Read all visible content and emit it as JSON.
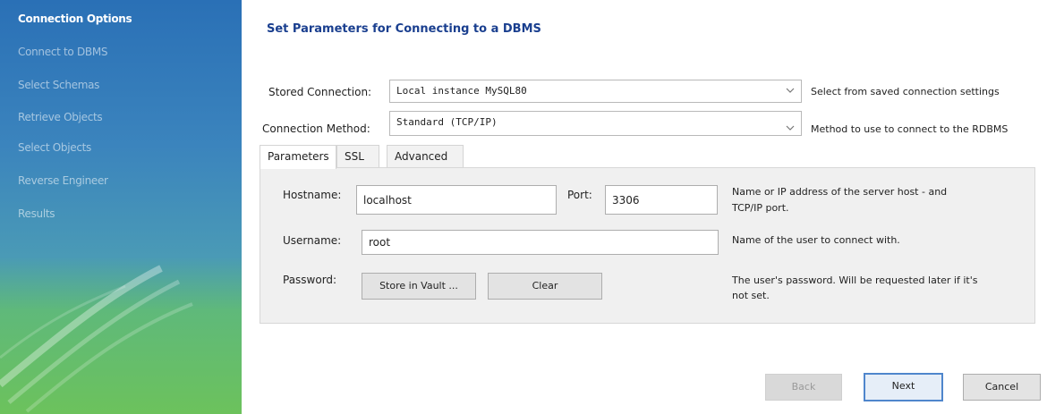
{
  "sidebar": {
    "items": [
      {
        "label": "Connection Options",
        "active": true
      },
      {
        "label": "Connect to DBMS",
        "active": false
      },
      {
        "label": "Select Schemas",
        "active": false
      },
      {
        "label": "Retrieve Objects",
        "active": false
      },
      {
        "label": "Select Objects",
        "active": false
      },
      {
        "label": "Reverse Engineer",
        "active": false
      },
      {
        "label": "Results",
        "active": false
      }
    ]
  },
  "main": {
    "title": "Set Parameters for Connecting to a DBMS",
    "stored_connection": {
      "label": "Stored Connection:",
      "value": "Local instance MySQL80",
      "hint": "Select from saved connection settings"
    },
    "connection_method": {
      "label": "Connection Method:",
      "value": "Standard (TCP/IP)",
      "hint": "Method to use to connect to the RDBMS"
    },
    "tabs": [
      {
        "label": "Parameters",
        "active": true
      },
      {
        "label": "SSL",
        "active": false
      },
      {
        "label": "Advanced",
        "active": false
      }
    ],
    "parameters": {
      "hostname_label": "Hostname:",
      "hostname_value": "localhost",
      "port_label": "Port:",
      "port_value": "3306",
      "hostname_hint_line1": "Name or IP address of the server host - and",
      "hostname_hint_line2": "TCP/IP port.",
      "username_label": "Username:",
      "username_value": "root",
      "username_hint": "Name of the user to connect with.",
      "password_label": "Password:",
      "store_in_vault_label": "Store in Vault ...",
      "clear_label": "Clear",
      "password_hint_line1": "The user's password. Will be requested later if it's",
      "password_hint_line2": "not set."
    }
  },
  "footer": {
    "back_label": "Back",
    "next_label": "Next",
    "cancel_label": "Cancel"
  },
  "colors": {
    "title": "#1a3f8f",
    "sidebar_top": "#2a70b6",
    "sidebar_bottom": "#6cc25c",
    "primary_border": "#4f86cc"
  }
}
